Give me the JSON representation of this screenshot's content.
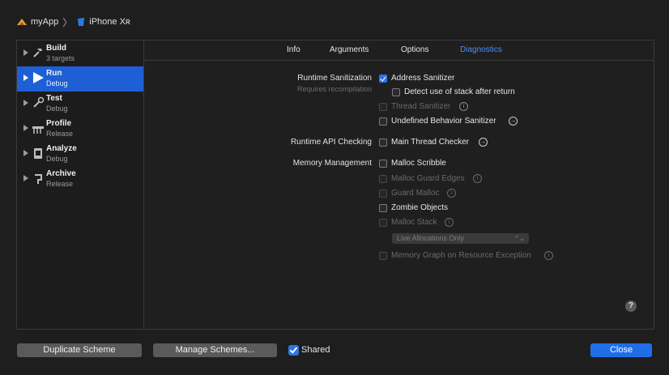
{
  "breadcrumb": {
    "app": "myApp",
    "device": "iPhone Xʀ"
  },
  "sidebar": {
    "items": [
      {
        "name": "Build",
        "sub": "3 targets",
        "icon": "hammer-icon"
      },
      {
        "name": "Run",
        "sub": "Debug",
        "icon": "play-icon",
        "selected": true
      },
      {
        "name": "Test",
        "sub": "Debug",
        "icon": "wrench-icon"
      },
      {
        "name": "Profile",
        "sub": "Release",
        "icon": "instruments-icon"
      },
      {
        "name": "Analyze",
        "sub": "Debug",
        "icon": "analyze-icon"
      },
      {
        "name": "Archive",
        "sub": "Release",
        "icon": "archive-icon"
      }
    ]
  },
  "tabs": [
    "Info",
    "Arguments",
    "Options",
    "Diagnostics"
  ],
  "active_tab": "Diagnostics",
  "diagnostics": {
    "runtime_sanitization": {
      "label": "Runtime Sanitization",
      "sublabel": "Requires recompilation",
      "address_sanitizer": "Address Sanitizer",
      "detect_stack": "Detect use of stack after return",
      "thread_sanitizer": "Thread Sanitizer",
      "ub_sanitizer": "Undefined Behavior Sanitizer"
    },
    "runtime_api": {
      "label": "Runtime API Checking",
      "main_thread_checker": "Main Thread Checker"
    },
    "memory": {
      "label": "Memory Management",
      "malloc_scribble": "Malloc Scribble",
      "malloc_guard_edges": "Malloc Guard Edges",
      "guard_malloc": "Guard Malloc",
      "zombie_objects": "Zombie Objects",
      "malloc_stack": "Malloc Stack",
      "alloc_option": "Live Allocations Only",
      "memory_graph": "Memory Graph on Resource Exception"
    },
    "help": "?"
  },
  "footer": {
    "duplicate": "Duplicate Scheme",
    "manage": "Manage Schemes...",
    "shared": "Shared",
    "close": "Close"
  },
  "colors": {
    "accent": "#1f6ee8",
    "selection": "#1f5fd6",
    "background": "#1e1e1f"
  }
}
